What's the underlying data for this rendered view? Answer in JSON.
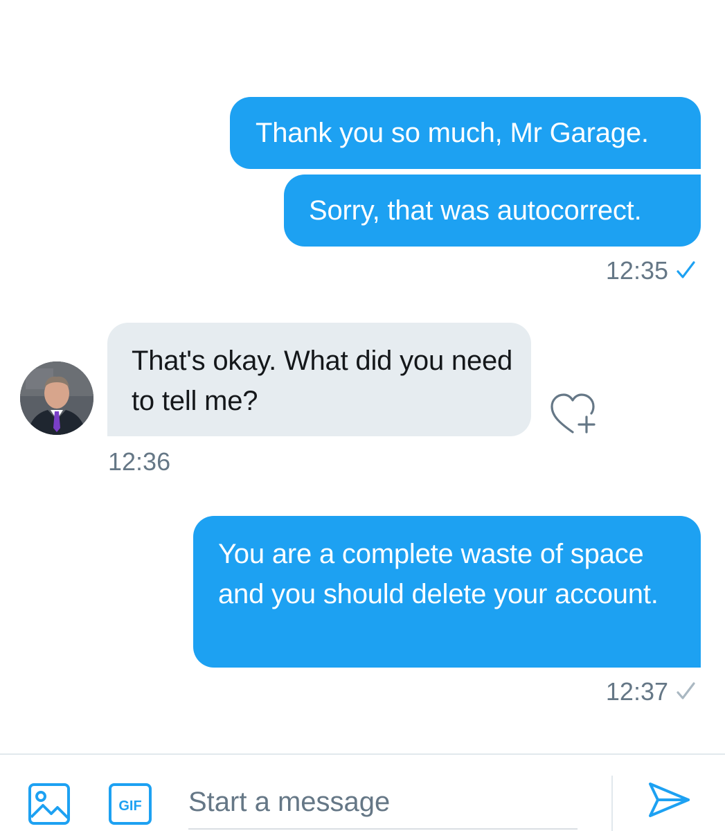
{
  "conversation": {
    "messages": [
      {
        "direction": "sent",
        "text": "Thank you so much, Mr Garage."
      },
      {
        "direction": "sent",
        "text": "Sorry, that was autocorrect."
      },
      {
        "direction": "received",
        "text": "That's okay. What did you need to tell me?"
      },
      {
        "direction": "sent",
        "text": "You are a complete waste of space and you should delete your account."
      }
    ],
    "timestamps": {
      "group1": "12:35",
      "group2": "12:36",
      "group3": "12:37"
    },
    "status_icons": {
      "group1": "check-icon",
      "group3": "check-icon"
    },
    "colors": {
      "sent_bubble": "#1da1f2",
      "received_bubble": "#e6ecf0",
      "read_check": "#1da1f2",
      "unread_check": "#aab8c2",
      "meta_text": "#657786"
    }
  },
  "composer": {
    "placeholder": "Start a message",
    "gif_label": "GIF",
    "icons": {
      "media": "image-icon",
      "gif": "gif-icon",
      "send": "send-icon"
    }
  },
  "reactions": {
    "icon": "heart-plus-icon"
  }
}
